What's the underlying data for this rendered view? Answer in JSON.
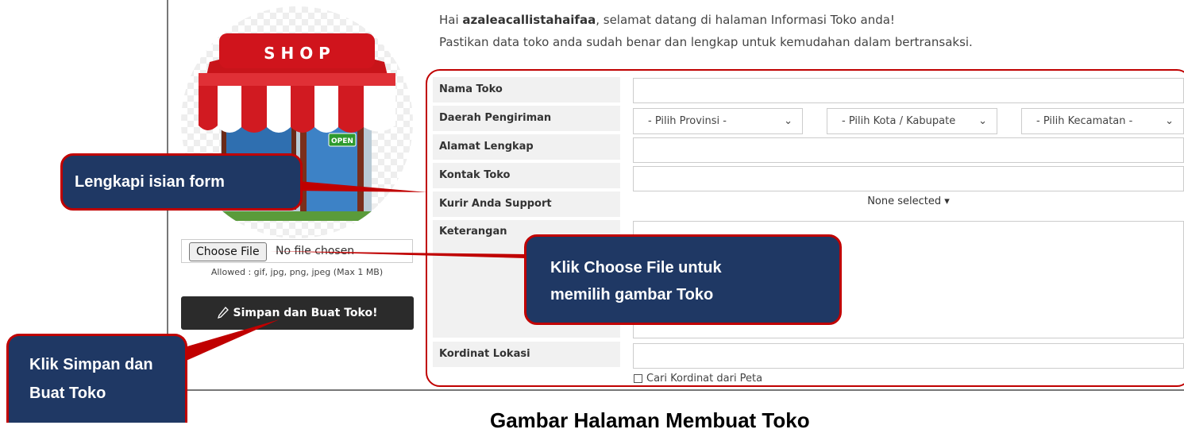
{
  "greeting": {
    "prefix": "Hai ",
    "username": "azaleacallistahaifaa",
    "suffix": ", selamat datang di halaman Informasi Toko anda!",
    "line2": "Pastikan data toko anda sudah benar dan lengkap untuk kemudahan dalam bertransaksi."
  },
  "shop_image": {
    "sign_text": "S H O P",
    "badge_text": "OPEN"
  },
  "upload": {
    "choose_label": "Choose File",
    "status": "No file chosen",
    "allowed": "Allowed : gif, jpg, png, jpeg (Max 1 MB)"
  },
  "save_button": {
    "label": "Simpan dan Buat Toko!"
  },
  "form": {
    "nama_toko": "Nama Toko",
    "daerah": "Daerah Pengiriman",
    "alamat": "Alamat Lengkap",
    "kontak": "Kontak Toko",
    "kurir": "Kurir Anda Support",
    "keterangan": "Keterangan",
    "kordinat": "Kordinat Lokasi",
    "provinsi": "- Pilih Provinsi -",
    "kota": "- Pilih Kota / Kabupate",
    "kecamatan": "- Pilih Kecamatan -",
    "kurir_value": "None selected",
    "checkbox_label": "Cari Kordinat dari Peta"
  },
  "callouts": {
    "form": "Lengkapi isian form",
    "choose_line1": "Klik Choose File untuk",
    "choose_line2": "memilih gambar Toko",
    "save_line1": "Klik Simpan dan",
    "save_line2": "Buat Toko"
  },
  "caption": "Gambar Halaman Membuat Toko",
  "colors": {
    "accent_red": "#c00000",
    "callout_blue": "#1f3864",
    "button_dark": "#2b2b2b"
  }
}
